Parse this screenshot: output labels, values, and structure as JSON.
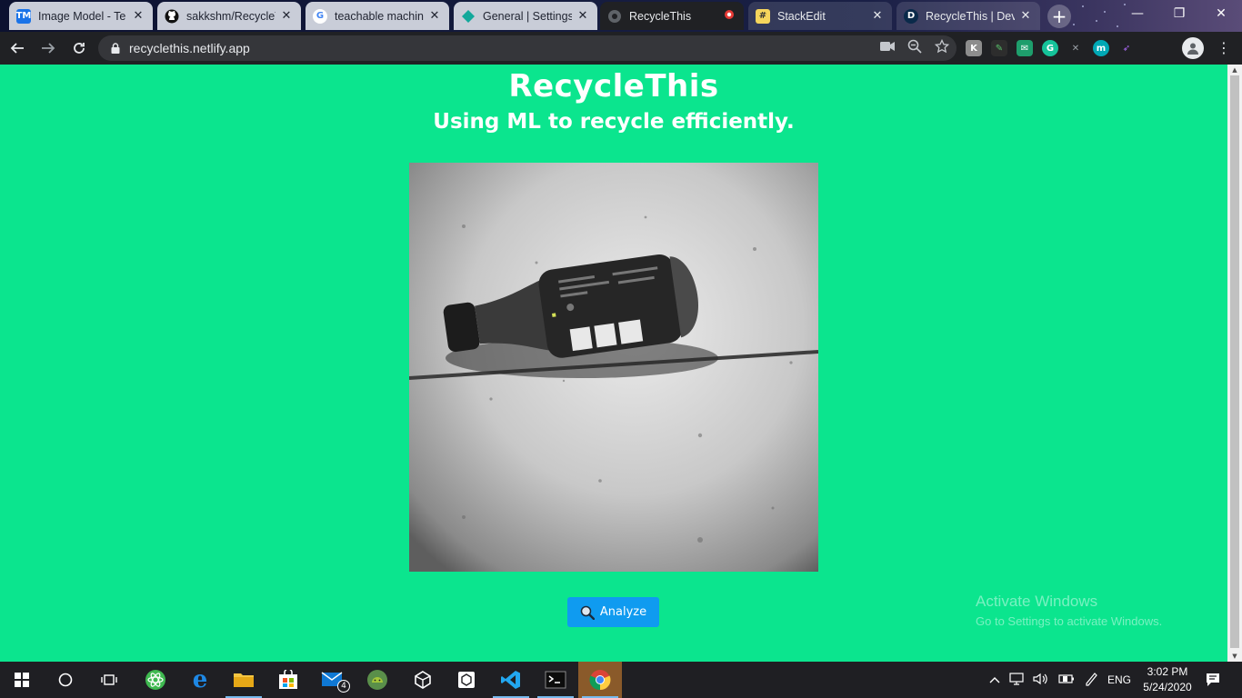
{
  "browser": {
    "tabs": [
      {
        "title": "Image Model - Te",
        "favicon": "tm-favicon",
        "favicon_text": "TM",
        "favicon_color": "#1a73e8"
      },
      {
        "title": "sakkshm/RecycleT",
        "favicon": "github-icon",
        "favicon_text": "",
        "favicon_color": "#111111"
      },
      {
        "title": "teachable machin",
        "favicon": "google-icon",
        "favicon_text": "G",
        "favicon_color": "#ffffff"
      },
      {
        "title": "General | Settings",
        "favicon": "diamond-icon",
        "favicon_text": "",
        "favicon_color": "#12a89b"
      },
      {
        "title": "RecycleThis",
        "favicon": "netlify-icon",
        "favicon_text": "",
        "favicon_color": "#5f6368"
      },
      {
        "title": "StackEdit",
        "favicon": "stackedit-icon",
        "favicon_text": "#",
        "favicon_color": "#f6d55c"
      },
      {
        "title": "RecycleThis | Dev",
        "favicon": "dev-icon",
        "favicon_text": "D",
        "favicon_color": "#0a2a4a"
      }
    ],
    "active_tab_index": 4,
    "url": "recyclethis.netlify.app"
  },
  "page": {
    "title": "RecycleThis",
    "subtitle": "Using ML to recycle efficiently.",
    "analyze_label": "Analyze"
  },
  "windows": {
    "watermark_title": "Activate Windows",
    "watermark_subtitle": "Go to Settings to activate Windows.",
    "language": "ENG",
    "time": "3:02 PM",
    "date": "5/24/2020",
    "mail_badge": "4"
  },
  "colors": {
    "page_bg": "#0be58e",
    "button_bg": "#0f9bf0",
    "browser_dark": "#202124",
    "taskbar": "#1f1f23"
  }
}
